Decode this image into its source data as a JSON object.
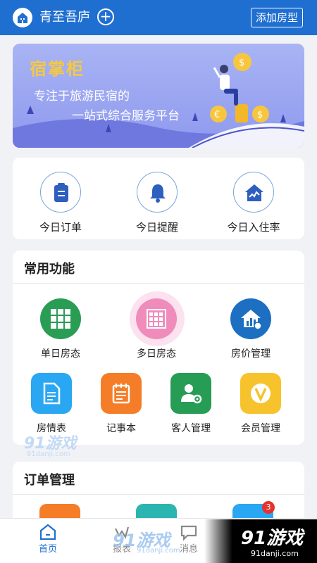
{
  "header": {
    "title": "青至吾庐",
    "add_icon": "plus-circle-icon",
    "add_room_label": "添加房型"
  },
  "banner": {
    "brand": "宿掌柜",
    "line1": "专注于旅游民宿的",
    "line2": "一站式综合服务平台"
  },
  "today": [
    {
      "label": "今日订单",
      "icon": "clipboard-icon"
    },
    {
      "label": "今日提醒",
      "icon": "bell-icon"
    },
    {
      "label": "今日入住率",
      "icon": "house-chart-icon"
    }
  ],
  "functions": {
    "title": "常用功能",
    "items": [
      {
        "label": "单日房态",
        "icon": "grid-icon",
        "color": "#2a9d55"
      },
      {
        "label": "多日房态",
        "icon": "calendar-grid-icon",
        "color": "#f08cbc"
      },
      {
        "label": "房价管理",
        "icon": "house-price-icon",
        "color": "#1d6fc2"
      },
      {
        "label": "房情表",
        "icon": "document-icon",
        "color": "#2aa7f2"
      },
      {
        "label": "记事本",
        "icon": "notepad-icon",
        "color": "#f57d28"
      },
      {
        "label": "客人管理",
        "icon": "user-gear-icon",
        "color": "#279c54"
      },
      {
        "label": "会员管理",
        "icon": "vip-icon",
        "color": "#f6c32c"
      }
    ]
  },
  "orders": {
    "title": "订单管理",
    "badge": "3"
  },
  "tabbar": [
    {
      "label": "首页",
      "icon": "home-icon",
      "active": true
    },
    {
      "label": "报表",
      "icon": "report-icon",
      "active": false
    },
    {
      "label": "消息",
      "icon": "message-icon",
      "active": false
    }
  ],
  "watermark": {
    "text": "91游戏",
    "site": "91danji.com"
  }
}
